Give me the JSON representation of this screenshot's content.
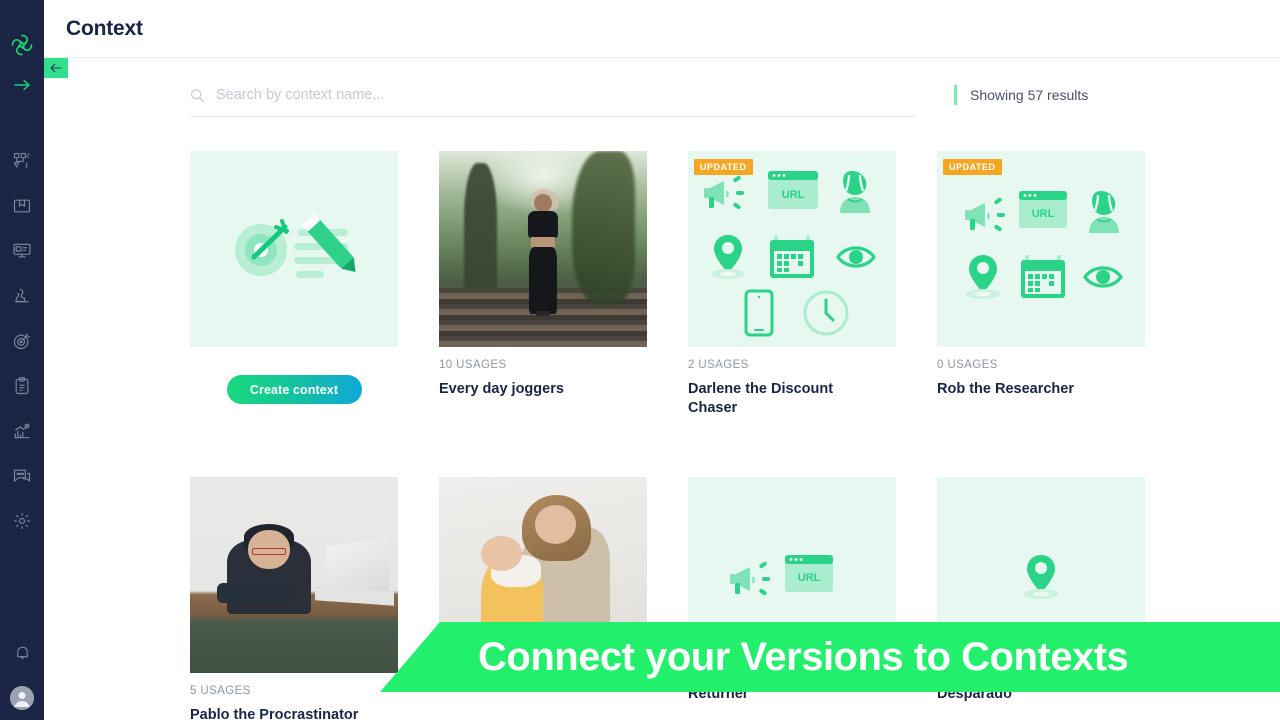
{
  "sidebar": {
    "logo_name": "app-logo",
    "expand_arrow_label": "→",
    "items": [
      {
        "name": "experiments-icon",
        "label": "Experiments"
      },
      {
        "name": "archive-box-icon",
        "label": "Library"
      },
      {
        "name": "monitor-icon",
        "label": "Campaigns"
      },
      {
        "name": "chess-knight-icon",
        "label": "Strategy"
      },
      {
        "name": "target-icon",
        "label": "Goals"
      },
      {
        "name": "clipboard-icon",
        "label": "Reports"
      },
      {
        "name": "analytics-icon",
        "label": "Analytics"
      },
      {
        "name": "chat-icon",
        "label": "Messages"
      },
      {
        "name": "gear-icon",
        "label": "Settings"
      }
    ],
    "bottom": [
      {
        "name": "bell-icon",
        "label": "Notifications"
      },
      {
        "name": "avatar",
        "label": "Account"
      }
    ]
  },
  "header": {
    "title": "Context",
    "collapse_label": "←"
  },
  "search": {
    "placeholder": "Search by context name...",
    "value": "",
    "icon": "search-icon"
  },
  "results": {
    "text": "Showing 57 results"
  },
  "create": {
    "button_label": "Create context",
    "illustration": "target-and-list-illustration"
  },
  "cards": [
    {
      "title": "Every day joggers",
      "usages": "10 USAGES",
      "badge": "",
      "thumb_type": "photo-jogger"
    },
    {
      "title": "Darlene the Discount Chaser",
      "usages": "2 USAGES",
      "badge": "UPDATED",
      "thumb_type": "icons-8"
    },
    {
      "title": "Rob the Researcher",
      "usages": "0 USAGES",
      "badge": "UPDATED",
      "thumb_type": "icons-6"
    },
    {
      "title": "Pablo the Procrastinator",
      "usages": "5 USAGES",
      "badge": "",
      "thumb_type": "photo-pablo"
    },
    {
      "title": "",
      "usages": "",
      "badge": "",
      "thumb_type": "photo-mom"
    },
    {
      "title": "Returner",
      "usages": "",
      "badge": "",
      "thumb_type": "icons-2"
    },
    {
      "title": "Desparado",
      "usages": "",
      "badge": "",
      "thumb_type": "icons-1"
    }
  ],
  "banner": {
    "text": "Connect your Versions to Contexts"
  },
  "colors": {
    "sidebar_bg": "#1b2445",
    "accent_green": "#22ef6b",
    "brand_green": "#30e08a",
    "badge_orange": "#f5a623",
    "title_navy": "#1b2445",
    "card_bg": "#e6f8f0",
    "meta_grey": "#9096a7"
  },
  "url_label": "URL"
}
